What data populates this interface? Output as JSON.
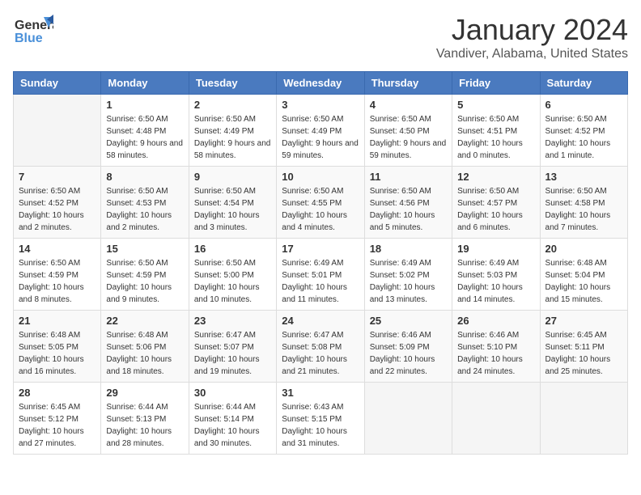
{
  "header": {
    "logo_general": "General",
    "logo_blue": "Blue",
    "month": "January 2024",
    "location": "Vandiver, Alabama, United States"
  },
  "weekdays": [
    "Sunday",
    "Monday",
    "Tuesday",
    "Wednesday",
    "Thursday",
    "Friday",
    "Saturday"
  ],
  "weeks": [
    [
      {
        "day": "",
        "sunrise": "",
        "sunset": "",
        "daylight": ""
      },
      {
        "day": "1",
        "sunrise": "Sunrise: 6:50 AM",
        "sunset": "Sunset: 4:48 PM",
        "daylight": "Daylight: 9 hours and 58 minutes."
      },
      {
        "day": "2",
        "sunrise": "Sunrise: 6:50 AM",
        "sunset": "Sunset: 4:49 PM",
        "daylight": "Daylight: 9 hours and 58 minutes."
      },
      {
        "day": "3",
        "sunrise": "Sunrise: 6:50 AM",
        "sunset": "Sunset: 4:49 PM",
        "daylight": "Daylight: 9 hours and 59 minutes."
      },
      {
        "day": "4",
        "sunrise": "Sunrise: 6:50 AM",
        "sunset": "Sunset: 4:50 PM",
        "daylight": "Daylight: 9 hours and 59 minutes."
      },
      {
        "day": "5",
        "sunrise": "Sunrise: 6:50 AM",
        "sunset": "Sunset: 4:51 PM",
        "daylight": "Daylight: 10 hours and 0 minutes."
      },
      {
        "day": "6",
        "sunrise": "Sunrise: 6:50 AM",
        "sunset": "Sunset: 4:52 PM",
        "daylight": "Daylight: 10 hours and 1 minute."
      }
    ],
    [
      {
        "day": "7",
        "sunrise": "Sunrise: 6:50 AM",
        "sunset": "Sunset: 4:52 PM",
        "daylight": "Daylight: 10 hours and 2 minutes."
      },
      {
        "day": "8",
        "sunrise": "Sunrise: 6:50 AM",
        "sunset": "Sunset: 4:53 PM",
        "daylight": "Daylight: 10 hours and 2 minutes."
      },
      {
        "day": "9",
        "sunrise": "Sunrise: 6:50 AM",
        "sunset": "Sunset: 4:54 PM",
        "daylight": "Daylight: 10 hours and 3 minutes."
      },
      {
        "day": "10",
        "sunrise": "Sunrise: 6:50 AM",
        "sunset": "Sunset: 4:55 PM",
        "daylight": "Daylight: 10 hours and 4 minutes."
      },
      {
        "day": "11",
        "sunrise": "Sunrise: 6:50 AM",
        "sunset": "Sunset: 4:56 PM",
        "daylight": "Daylight: 10 hours and 5 minutes."
      },
      {
        "day": "12",
        "sunrise": "Sunrise: 6:50 AM",
        "sunset": "Sunset: 4:57 PM",
        "daylight": "Daylight: 10 hours and 6 minutes."
      },
      {
        "day": "13",
        "sunrise": "Sunrise: 6:50 AM",
        "sunset": "Sunset: 4:58 PM",
        "daylight": "Daylight: 10 hours and 7 minutes."
      }
    ],
    [
      {
        "day": "14",
        "sunrise": "Sunrise: 6:50 AM",
        "sunset": "Sunset: 4:59 PM",
        "daylight": "Daylight: 10 hours and 8 minutes."
      },
      {
        "day": "15",
        "sunrise": "Sunrise: 6:50 AM",
        "sunset": "Sunset: 4:59 PM",
        "daylight": "Daylight: 10 hours and 9 minutes."
      },
      {
        "day": "16",
        "sunrise": "Sunrise: 6:50 AM",
        "sunset": "Sunset: 5:00 PM",
        "daylight": "Daylight: 10 hours and 10 minutes."
      },
      {
        "day": "17",
        "sunrise": "Sunrise: 6:49 AM",
        "sunset": "Sunset: 5:01 PM",
        "daylight": "Daylight: 10 hours and 11 minutes."
      },
      {
        "day": "18",
        "sunrise": "Sunrise: 6:49 AM",
        "sunset": "Sunset: 5:02 PM",
        "daylight": "Daylight: 10 hours and 13 minutes."
      },
      {
        "day": "19",
        "sunrise": "Sunrise: 6:49 AM",
        "sunset": "Sunset: 5:03 PM",
        "daylight": "Daylight: 10 hours and 14 minutes."
      },
      {
        "day": "20",
        "sunrise": "Sunrise: 6:48 AM",
        "sunset": "Sunset: 5:04 PM",
        "daylight": "Daylight: 10 hours and 15 minutes."
      }
    ],
    [
      {
        "day": "21",
        "sunrise": "Sunrise: 6:48 AM",
        "sunset": "Sunset: 5:05 PM",
        "daylight": "Daylight: 10 hours and 16 minutes."
      },
      {
        "day": "22",
        "sunrise": "Sunrise: 6:48 AM",
        "sunset": "Sunset: 5:06 PM",
        "daylight": "Daylight: 10 hours and 18 minutes."
      },
      {
        "day": "23",
        "sunrise": "Sunrise: 6:47 AM",
        "sunset": "Sunset: 5:07 PM",
        "daylight": "Daylight: 10 hours and 19 minutes."
      },
      {
        "day": "24",
        "sunrise": "Sunrise: 6:47 AM",
        "sunset": "Sunset: 5:08 PM",
        "daylight": "Daylight: 10 hours and 21 minutes."
      },
      {
        "day": "25",
        "sunrise": "Sunrise: 6:46 AM",
        "sunset": "Sunset: 5:09 PM",
        "daylight": "Daylight: 10 hours and 22 minutes."
      },
      {
        "day": "26",
        "sunrise": "Sunrise: 6:46 AM",
        "sunset": "Sunset: 5:10 PM",
        "daylight": "Daylight: 10 hours and 24 minutes."
      },
      {
        "day": "27",
        "sunrise": "Sunrise: 6:45 AM",
        "sunset": "Sunset: 5:11 PM",
        "daylight": "Daylight: 10 hours and 25 minutes."
      }
    ],
    [
      {
        "day": "28",
        "sunrise": "Sunrise: 6:45 AM",
        "sunset": "Sunset: 5:12 PM",
        "daylight": "Daylight: 10 hours and 27 minutes."
      },
      {
        "day": "29",
        "sunrise": "Sunrise: 6:44 AM",
        "sunset": "Sunset: 5:13 PM",
        "daylight": "Daylight: 10 hours and 28 minutes."
      },
      {
        "day": "30",
        "sunrise": "Sunrise: 6:44 AM",
        "sunset": "Sunset: 5:14 PM",
        "daylight": "Daylight: 10 hours and 30 minutes."
      },
      {
        "day": "31",
        "sunrise": "Sunrise: 6:43 AM",
        "sunset": "Sunset: 5:15 PM",
        "daylight": "Daylight: 10 hours and 31 minutes."
      },
      {
        "day": "",
        "sunrise": "",
        "sunset": "",
        "daylight": ""
      },
      {
        "day": "",
        "sunrise": "",
        "sunset": "",
        "daylight": ""
      },
      {
        "day": "",
        "sunrise": "",
        "sunset": "",
        "daylight": ""
      }
    ]
  ]
}
